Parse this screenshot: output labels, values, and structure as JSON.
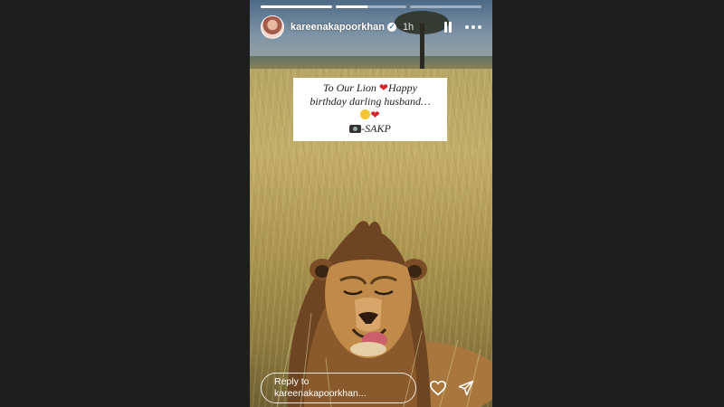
{
  "story": {
    "username": "kareenakapoorkhan",
    "time": "1h",
    "progress": [
      1,
      0.45,
      0
    ],
    "caption": {
      "line1_text": "To Our Lion",
      "line1_suffix": "Happy",
      "line2": "birthday darling husband…",
      "signature": "SAKP"
    },
    "reply_line1": "Reply to",
    "reply_line2": "kareenakapoorkhan...",
    "icons": {
      "verified": "verified-badge-icon",
      "pause": "pause-icon",
      "more": "more-options-icon",
      "like": "heart-icon",
      "share": "send-icon"
    }
  }
}
